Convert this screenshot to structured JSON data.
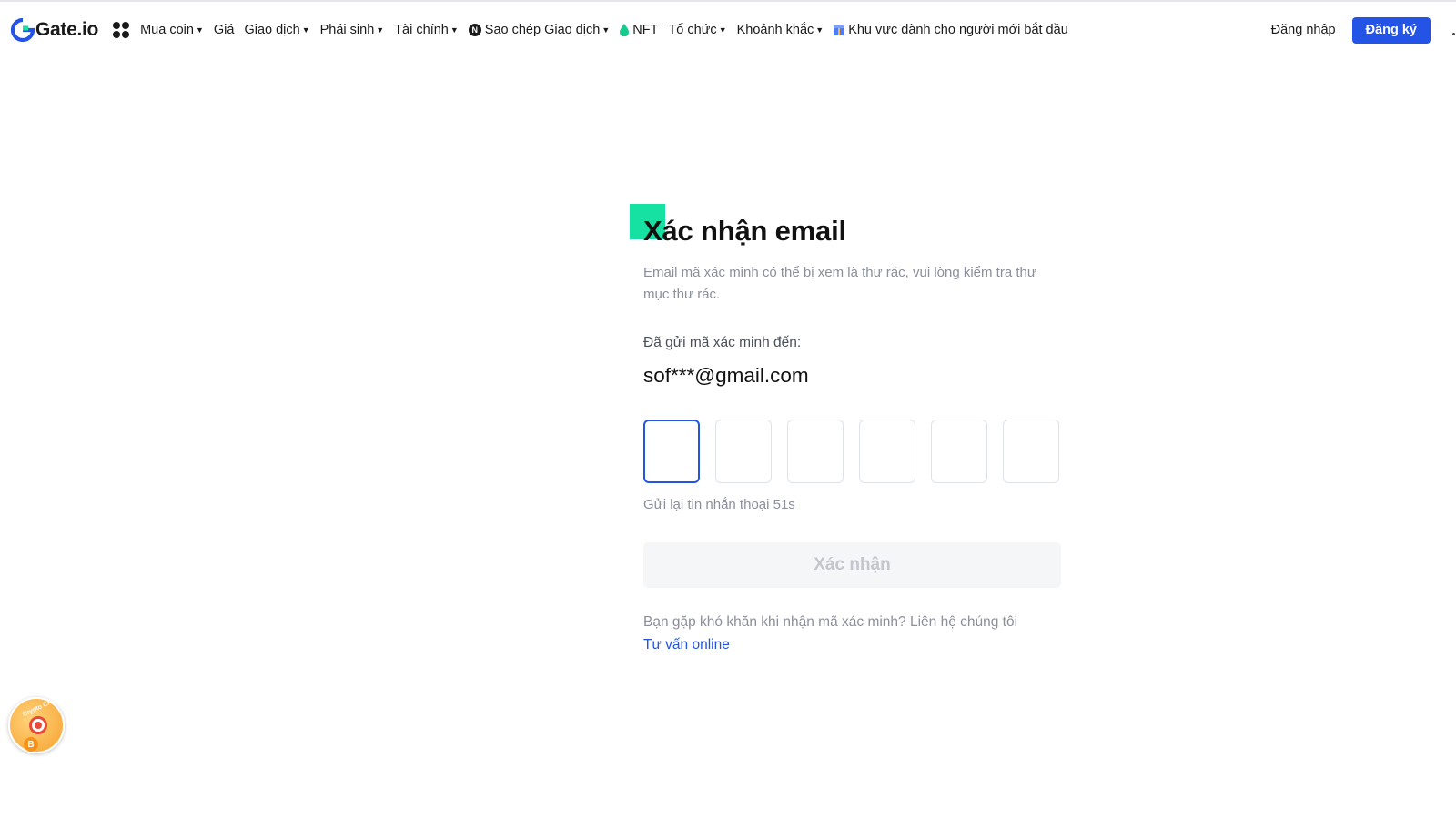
{
  "brand": {
    "name": "Gate.io",
    "accent": "#2354e6",
    "logo_color": "#2354e6"
  },
  "nav": {
    "items": [
      {
        "label": "Mua coin",
        "has_caret": true
      },
      {
        "label": "Giá",
        "has_caret": false
      },
      {
        "label": "Giao dịch",
        "has_caret": true
      },
      {
        "label": "Phái sinh",
        "has_caret": true
      },
      {
        "label": "Tài chính",
        "has_caret": true
      },
      {
        "label": "Sao chép Giao dịch",
        "has_caret": true,
        "icon": "n-badge-icon"
      },
      {
        "label": "NFT",
        "has_caret": false,
        "icon": "nft-drop-icon"
      },
      {
        "label": "Tổ chức",
        "has_caret": true
      },
      {
        "label": "Khoảnh khắc",
        "has_caret": true
      },
      {
        "label": "Khu vực dành cho người mới bắt đầu",
        "has_caret": false,
        "icon": "gift-box-icon"
      }
    ],
    "caret": "▼",
    "login_label": "Đăng nhập",
    "signup_label": "Đăng ký"
  },
  "verify": {
    "title": "Xác nhận email",
    "subtitle": "Email mã xác minh có thể bị xem là thư rác, vui lòng kiểm tra thư mục thư rác.",
    "sent_label": "Đã gửi mã xác minh đến:",
    "email": "sof***@gmail.com",
    "otp_values": [
      "",
      "",
      "",
      "",
      "",
      ""
    ],
    "resend_text": "Gửi lại tin nhắn thoại 51s",
    "confirm_label": "Xác nhận",
    "help_text": "Bạn gặp khó khăn khi nhận mã xác minh? Liên hệ chúng tôi",
    "help_link": "Tư vấn online"
  },
  "float_badge": {
    "text": "Crypto Crush 20"
  },
  "colors": {
    "green_accent": "#17e0a3",
    "muted_text": "#8a8f99",
    "disabled_bg": "#f5f6f7"
  }
}
